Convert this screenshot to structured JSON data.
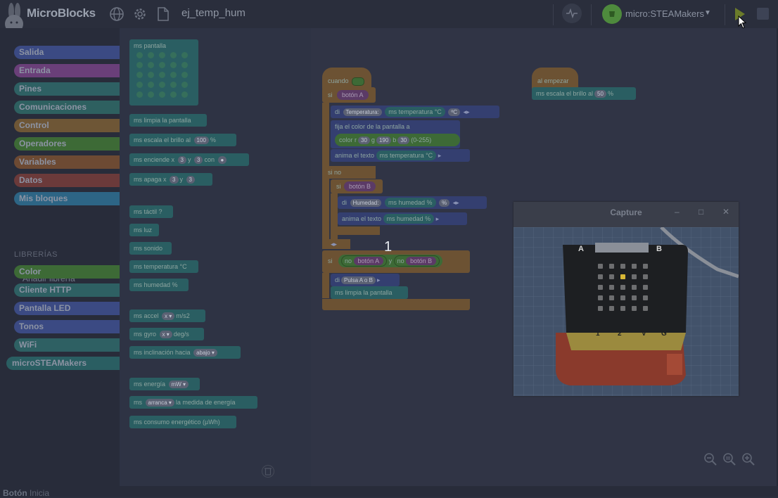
{
  "app": {
    "title": "MicroBlocks",
    "project_name": "ej_temp_hum",
    "board_name": "micro:STEAMakers",
    "icons": [
      "rabbit-logo-icon",
      "globe-icon",
      "gear-icon",
      "file-icon",
      "graph-icon",
      "board-icon",
      "chevron-down-icon",
      "play-icon",
      "stop-icon",
      "cursor-icon"
    ]
  },
  "sidebar": {
    "categories": [
      {
        "label": "Salida",
        "color": "#3b4a83"
      },
      {
        "label": "Entrada",
        "color": "#6a3f79"
      },
      {
        "label": "Pines",
        "color": "#2e6063"
      },
      {
        "label": "Comunicaciones",
        "color": "#2e6060"
      },
      {
        "label": "Control",
        "color": "#6e5636"
      },
      {
        "label": "Operadores",
        "color": "#3d6a36"
      },
      {
        "label": "Variables",
        "color": "#6d4a33"
      },
      {
        "label": "Datos",
        "color": "#6b3a3a"
      },
      {
        "label": "Mis bloques",
        "color": "#2d6585"
      }
    ],
    "libraries_header": "LIBRERÍAS",
    "add_library": "Añadir librería",
    "libraries": [
      {
        "label": "Color",
        "color": "#3d6a36"
      },
      {
        "label": "Cliente HTTP",
        "color": "#2e6063"
      },
      {
        "label": "Pantalla LED",
        "color": "#3b4a83"
      },
      {
        "label": "Tonos",
        "color": "#3b4a83"
      },
      {
        "label": "WiFi",
        "color": "#2e6063"
      },
      {
        "label": "microSTEAMakers",
        "color": "#2a5e62"
      }
    ]
  },
  "status": {
    "label": "Botón",
    "action": "Inicia"
  },
  "palette": {
    "led_block_label": "ms pantalla",
    "blocks": [
      {
        "parts": [
          {
            "t": "ms limpia la pantalla"
          }
        ]
      },
      {
        "parts": [
          {
            "t": "ms escala el brillo al"
          },
          {
            "s": "100"
          },
          {
            "t": "%"
          }
        ]
      },
      {
        "parts": [
          {
            "t": "ms enciende x"
          },
          {
            "s": "3"
          },
          {
            "t": "y"
          },
          {
            "s": "3"
          },
          {
            "t": "con"
          },
          {
            "s": "●"
          }
        ]
      },
      {
        "parts": [
          {
            "t": "ms apaga x"
          },
          {
            "s": "3"
          },
          {
            "t": "y"
          },
          {
            "s": "3"
          }
        ]
      },
      {
        "parts": [
          {
            "t": "ms táctil ?"
          }
        ]
      },
      {
        "parts": [
          {
            "t": "ms luz"
          }
        ]
      },
      {
        "parts": [
          {
            "t": "ms sonido"
          }
        ]
      },
      {
        "parts": [
          {
            "t": "ms temperatura °C"
          }
        ]
      },
      {
        "parts": [
          {
            "t": "ms humedad %"
          }
        ]
      },
      {
        "parts": [
          {
            "t": "ms accel"
          },
          {
            "s": "x ▾"
          },
          {
            "t": "m/s2"
          }
        ]
      },
      {
        "parts": [
          {
            "t": "ms gyro"
          },
          {
            "s": "x ▾"
          },
          {
            "t": "deg/s"
          }
        ]
      },
      {
        "parts": [
          {
            "t": "ms inclinación hacia"
          },
          {
            "s": "abajo ▾"
          }
        ]
      },
      {
        "parts": [
          {
            "t": "ms energía"
          },
          {
            "s": "mW ▾"
          }
        ]
      },
      {
        "parts": [
          {
            "t": "ms"
          },
          {
            "s": "arranca ▾"
          },
          {
            "t": "la medida de energía"
          }
        ]
      },
      {
        "parts": [
          {
            "t": "ms consumo energético (µWh)"
          }
        ]
      }
    ]
  },
  "script": {
    "hat1": "cuando",
    "if_label": "si",
    "boton_a": "botón A",
    "di": "di",
    "temperatura_text": "Temperatura:",
    "ms_temperatura": "ms temperatura °C",
    "celsius_text": "ºC",
    "fija_color": "fija el color de la pantalla a",
    "color_r": "color r",
    "r_val": "30",
    "g_label": "g",
    "g_val": "190",
    "b_label": "b",
    "b_val": "30",
    "range": "(0-255)",
    "anima_texto": "anima el texto",
    "else_label": "si no",
    "boton_b": "botón B",
    "humedad_text": "Humedad:",
    "ms_humedad": "ms humedad %",
    "percent_text": "%",
    "no_label": "no",
    "y_label": "y",
    "pulsa_text": "Pulsa A o B",
    "ms_limpia": "ms limpia la pantalla",
    "counter": "1",
    "hat2": "al empezar",
    "escala_brillo": "ms escala el brillo al",
    "brillo_val": "50",
    "percent": "%"
  },
  "capture": {
    "title": "Capture",
    "minimize": "–",
    "maximize": "□",
    "close": "✕",
    "board_labels": {
      "a": "A",
      "b": "B",
      "pin_1": "1",
      "pin_2": "2",
      "pin_v": "V",
      "pin_g": "G"
    }
  }
}
